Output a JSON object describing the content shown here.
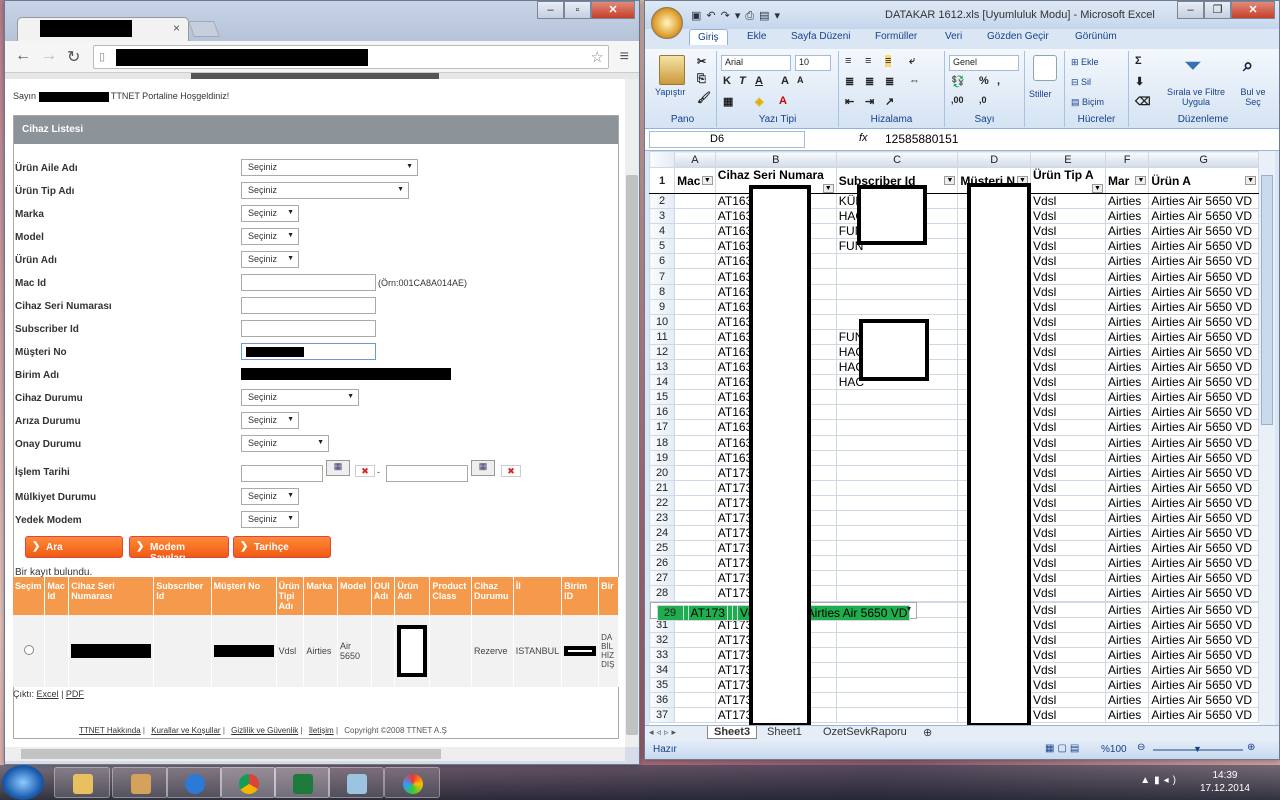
{
  "browser": {
    "tab_close": "×",
    "page": {
      "welcome_prefix": "Sayın ",
      "welcome_suffix": " TTNET Portaline Hoşgeldiniz!",
      "panel_title": "Cihaz Listesi",
      "fields": {
        "urun_aile": {
          "label": "Ürün Aile Adı",
          "value": "Seçiniz"
        },
        "urun_tip": {
          "label": "Ürün Tip Adı",
          "value": "Seçiniz"
        },
        "marka": {
          "label": "Marka",
          "value": "Seçiniz"
        },
        "model": {
          "label": "Model",
          "value": "Seçiniz"
        },
        "urun_adi": {
          "label": "Ürün Adı",
          "value": "Seçiniz"
        },
        "mac_id": {
          "label": "Mac Id",
          "hint": "(Örn:001CA8A014AE)"
        },
        "cihaz_seri": {
          "label": "Cihaz Seri Numarası"
        },
        "subscriber": {
          "label": "Subscriber Id"
        },
        "musteri_no": {
          "label": "Müşteri No"
        },
        "birim_adi": {
          "label": "Birim Adı"
        },
        "cihaz_durumu": {
          "label": "Cihaz Durumu",
          "value": "Seçiniz"
        },
        "ariza_durumu": {
          "label": "Arıza Durumu",
          "value": "Seçiniz"
        },
        "onay_durumu": {
          "label": "Onay Durumu",
          "value": "Seçiniz"
        },
        "islem_tarihi": {
          "label": "İşlem Tarihi",
          "sep": "-"
        },
        "mulkiyet": {
          "label": "Mülkiyet Durumu",
          "value": "Seçiniz"
        },
        "yedek_modem": {
          "label": "Yedek Modem",
          "value": "Seçiniz"
        }
      },
      "buttons": {
        "ara": "Ara",
        "modem_sayilari": "Modem Sayıları",
        "tarihce": "Tarihçe"
      },
      "result_count": "Bir kayıt bulundu.",
      "table_headers": [
        "Seçim",
        "Mac Id",
        "Cihaz Seri Numarası",
        "Subscriber Id",
        "Müşteri No",
        "Ürün Tipi Adı",
        "Marka",
        "Model",
        "OUI Adı",
        "Ürün Adı",
        "Product Class",
        "Cihaz Durumu",
        "İl",
        "Birim ID",
        "Bir"
      ],
      "row": {
        "urun_tipi": "Vdsl",
        "marka": "Airties",
        "model": "Air 5650",
        "cihaz_durumu": "Rezerve",
        "il": "ISTANBUL",
        "birim": "DA BİL HİZ DIŞ"
      },
      "export": {
        "label": "Çıktı:",
        "excel": "Excel",
        "sep": "|",
        "pdf": "PDF"
      },
      "footer": [
        "TTNET Hakkında",
        "Kurallar ve Koşullar",
        "Gizlilik ve Güvenlik",
        "İletişim"
      ],
      "footer_sep": "|",
      "copyright": "Copyright ©2008 TTNET A.Ş"
    }
  },
  "excel": {
    "title": "DATAKAR 1612.xls  [Uyumluluk Modu]  -  Microsoft Excel",
    "ribbon_tabs": [
      "Giriş",
      "Ekle",
      "Sayfa Düzeni",
      "Formüller",
      "Veri",
      "Gözden Geçir",
      "Görünüm"
    ],
    "groups": {
      "pano": "Pano",
      "yazi_tipi": "Yazı Tipi",
      "hizalama": "Hizalama",
      "sayi": "Sayı",
      "hucreler": "Hücreler",
      "duzenleme": "Düzenleme"
    },
    "font_name": "Arial",
    "font_size": "10",
    "number_format": "Genel",
    "labels": {
      "yapistir": "Yapıştır",
      "stiller": "Stiller",
      "ekle": "Ekle",
      "sil": "Sil",
      "bicim": "Biçim",
      "sirala": "Sırala ve Filtre Uygula",
      "bul": "Bul ve Seç"
    },
    "name_box": "D6",
    "formula_value": "12585880151",
    "columns": [
      "A",
      "B",
      "C",
      "D",
      "E",
      "F",
      "G"
    ],
    "headers": [
      "Mac",
      "Cihaz Seri Numara",
      "Subscriber Id",
      "Müşteri N",
      "Ürün Tip A",
      "Mar",
      "Ürün A"
    ],
    "subscriber_values": {
      "2": "KÜE",
      "2b": "U",
      "3": "HAC",
      "4": "FUN",
      "5": "FUN",
      "11": "FUN",
      "12": "HAC",
      "13": "HAC",
      "14": "HAC"
    },
    "row_data": {
      "vdsl": "Vdsl",
      "airties": "Airties",
      "model": "Airties Air 5650 VD",
      "at163": "AT163",
      "at173": "AT173"
    },
    "selected_row": 29,
    "sheet_tabs": [
      "Sheet3",
      "Sheet1",
      "OzetSevkRaporu"
    ],
    "status": "Hazır",
    "zoom": "%100"
  },
  "taskbar": {
    "time": "14:39",
    "date": "17.12.2014"
  }
}
